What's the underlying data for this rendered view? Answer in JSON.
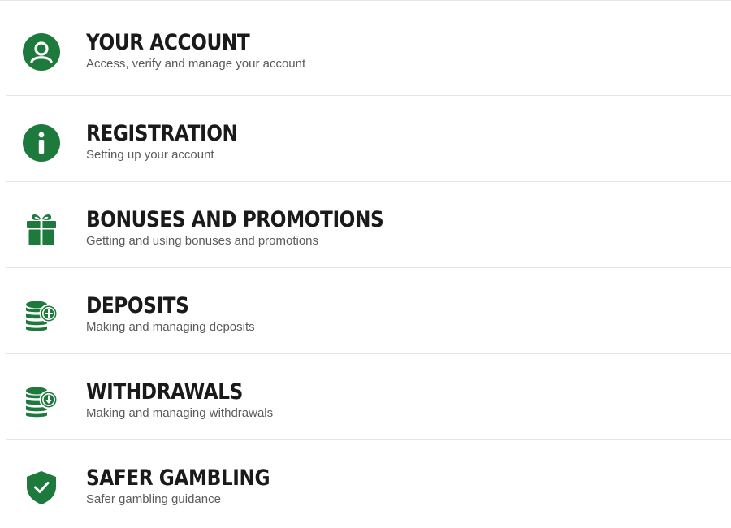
{
  "accent_color": "#1e7a3c",
  "items": [
    {
      "icon": "user-circle-icon",
      "title": "YOUR ACCOUNT",
      "subtitle": "Access, verify and manage your account"
    },
    {
      "icon": "info-circle-icon",
      "title": "REGISTRATION",
      "subtitle": "Setting up your account"
    },
    {
      "icon": "gift-icon",
      "title": "BONUSES AND PROMOTIONS",
      "subtitle": "Getting and using bonuses and promotions"
    },
    {
      "icon": "coins-plus-icon",
      "title": "DEPOSITS",
      "subtitle": "Making and managing deposits"
    },
    {
      "icon": "coins-download-icon",
      "title": "WITHDRAWALS",
      "subtitle": "Making and managing withdrawals"
    },
    {
      "icon": "shield-check-icon",
      "title": "SAFER GAMBLING",
      "subtitle": "Safer gambling guidance"
    }
  ]
}
